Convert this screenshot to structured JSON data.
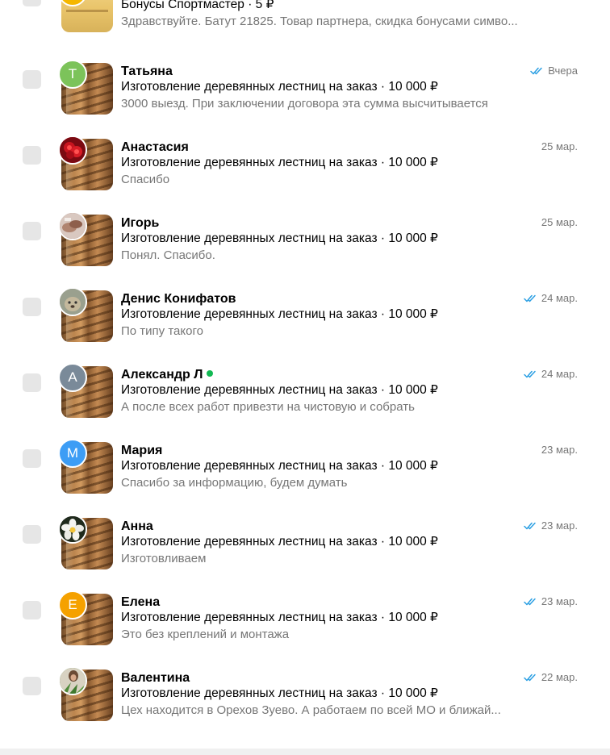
{
  "chats": [
    {
      "name": "",
      "subject": "Бонусы Спортмастер · 5 ₽",
      "preview": "Здравствуйте. Батут 21825. Товар партнера, скидка бонусами симво...",
      "date": "",
      "read": false,
      "online": false,
      "avatar": {
        "type": "color",
        "letter": "",
        "color": "#f5b700"
      },
      "thumb": "bonus"
    },
    {
      "name": "Татьяна",
      "subject": "Изготовление деревянных лестниц на заказ · 10 000 ₽",
      "preview": "3000 выезд. При заключении договора эта сумма высчитывается",
      "date": "Вчера",
      "read": true,
      "online": false,
      "avatar": {
        "type": "color",
        "letter": "Т",
        "color": "#7cc35a"
      },
      "thumb": "stairs"
    },
    {
      "name": "Анастасия",
      "subject": "Изготовление деревянных лестниц на заказ · 10 000 ₽",
      "preview": "Спасибо",
      "date": "25 мар.",
      "read": false,
      "online": false,
      "avatar": {
        "type": "photo-roses",
        "letter": "",
        "color": "#b3121f"
      },
      "thumb": "stairs"
    },
    {
      "name": "Игорь",
      "subject": "Изготовление деревянных лестниц на заказ · 10 000 ₽",
      "preview": "Понял. Спасибо.",
      "date": "25 мар.",
      "read": false,
      "online": false,
      "avatar": {
        "type": "photo-hands",
        "letter": "",
        "color": "#a07868"
      },
      "thumb": "stairs"
    },
    {
      "name": "Денис Конифатов",
      "subject": "Изготовление деревянных лестниц на заказ · 10 000 ₽",
      "preview": "По типу такого",
      "date": "24 мар.",
      "read": true,
      "online": false,
      "avatar": {
        "type": "photo-dog",
        "letter": "",
        "color": "#8a8a7a"
      },
      "thumb": "stairs"
    },
    {
      "name": "Александр Л",
      "subject": "Изготовление деревянных лестниц на заказ · 10 000 ₽",
      "preview": "А после всех работ привезти на чистовую и собрать",
      "date": "24 мар.",
      "read": true,
      "online": true,
      "avatar": {
        "type": "color",
        "letter": "А",
        "color": "#7a8a99"
      },
      "thumb": "stairs"
    },
    {
      "name": "Мария",
      "subject": "Изготовление деревянных лестниц на заказ · 10 000 ₽",
      "preview": "Спасибо за информацию, будем думать",
      "date": "23 мар.",
      "read": false,
      "online": false,
      "avatar": {
        "type": "color",
        "letter": "М",
        "color": "#3d9df5"
      },
      "thumb": "stairs"
    },
    {
      "name": "Анна",
      "subject": "Изготовление деревянных лестниц на заказ · 10 000 ₽",
      "preview": "Изготовливаем",
      "date": "23 мар.",
      "read": true,
      "online": false,
      "avatar": {
        "type": "photo-flower",
        "letter": "",
        "color": "#1f1f1f"
      },
      "thumb": "stairs"
    },
    {
      "name": "Елена",
      "subject": "Изготовление деревянных лестниц на заказ · 10 000 ₽",
      "preview": "Это без креплений и монтажа",
      "date": "23 мар.",
      "read": true,
      "online": false,
      "avatar": {
        "type": "color",
        "letter": "Е",
        "color": "#f5a100"
      },
      "thumb": "stairs"
    },
    {
      "name": "Валентина",
      "subject": "Изготовление деревянных лестниц на заказ · 10 000 ₽",
      "preview": "Цех находится в Орехов Зуево. А работаем по всей МО и ближай...",
      "date": "22 мар.",
      "read": true,
      "online": false,
      "avatar": {
        "type": "photo-plant",
        "letter": "",
        "color": "#4f7a3a"
      },
      "thumb": "stairs"
    }
  ],
  "colors": {
    "read_check": "#2b9fe3",
    "online": "#12b953",
    "muted_text": "#767676",
    "checkbox": "#e6e6e6"
  }
}
